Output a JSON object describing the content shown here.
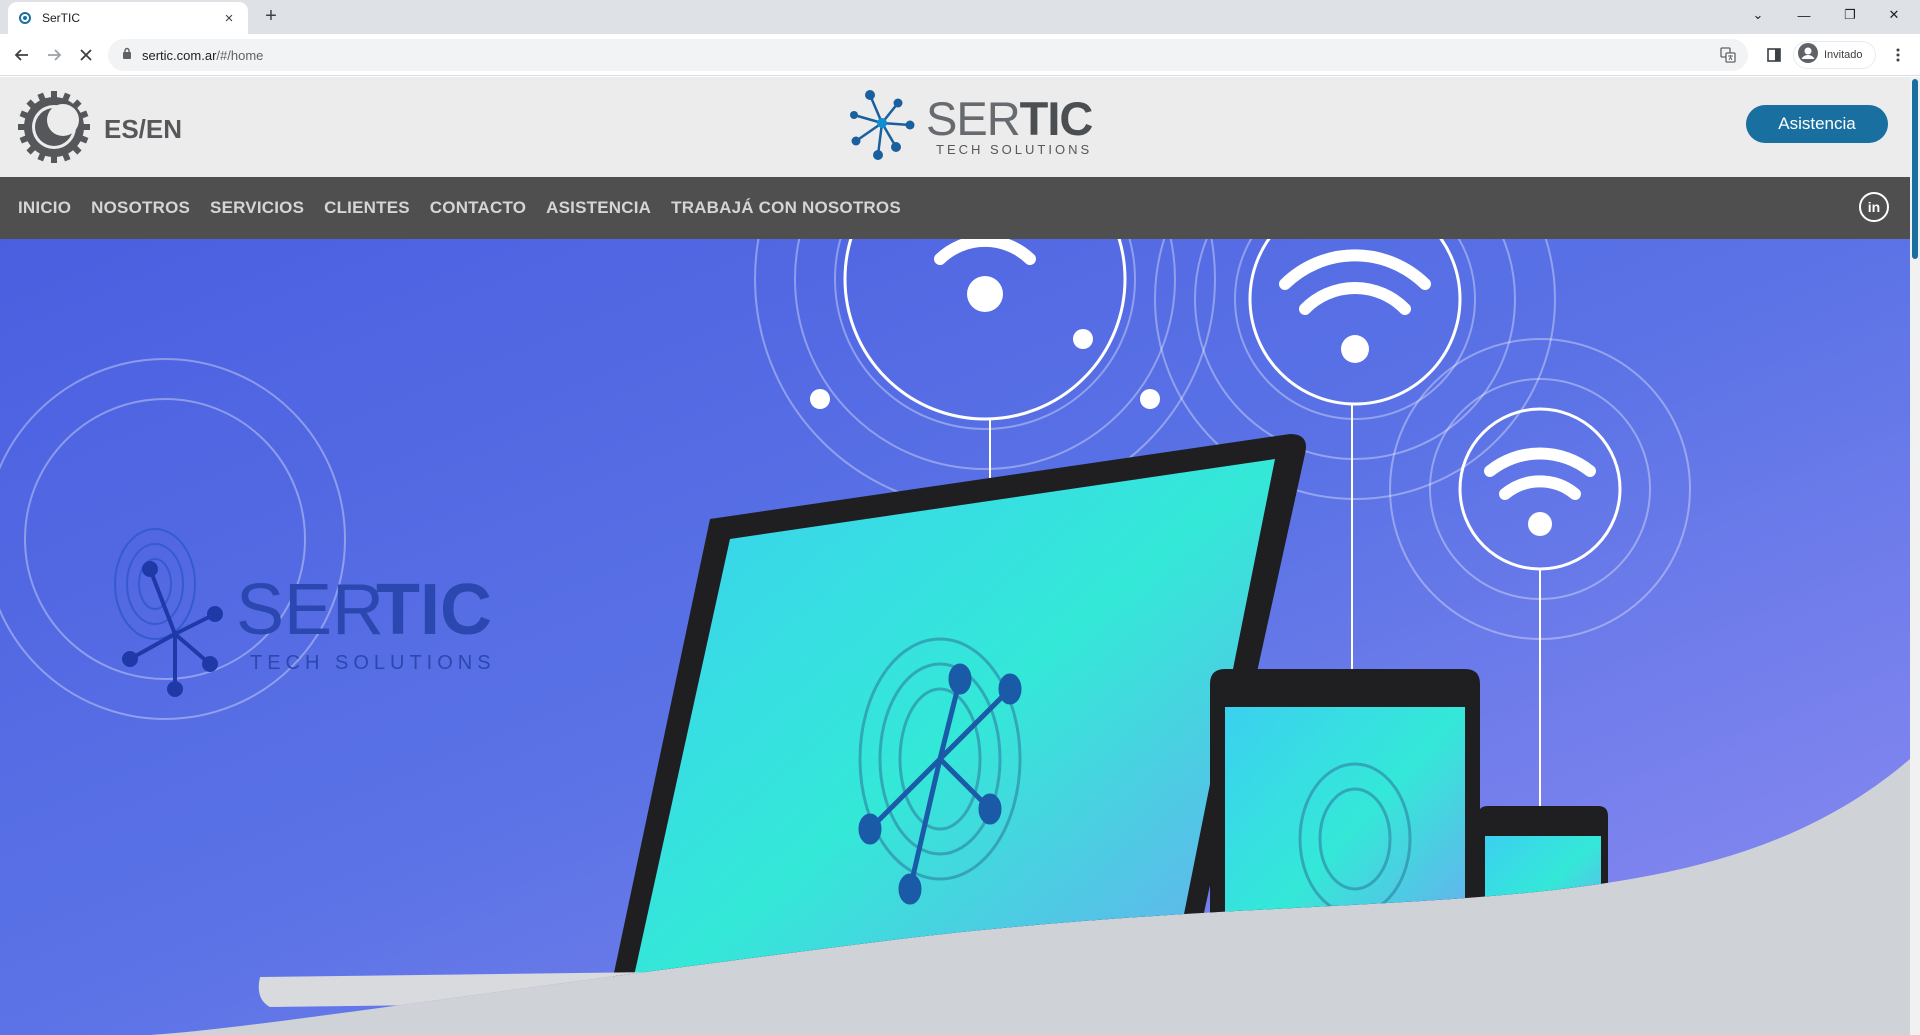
{
  "browser": {
    "tab_title": "SerTIC",
    "tab_close": "×",
    "new_tab": "+",
    "url_host": "sertic.com.ar",
    "url_path": "/#/home",
    "profile_label": "Invitado",
    "window_controls": [
      "⌄",
      "—",
      "❐",
      "✕"
    ]
  },
  "header": {
    "lang_toggle": "ES/EN",
    "brand_ser": "SER",
    "brand_tic": "TIC",
    "brand_tagline": "TECH SOLUTIONS",
    "asistencia_button": "Asistencia"
  },
  "nav": {
    "items": [
      "INICIO",
      "NOSOTROS",
      "SERVICIOS",
      "CLIENTES",
      "CONTACTO",
      "ASISTENCIA",
      "TRABAJÁ CON NOSOTROS"
    ],
    "linkedin": "in"
  },
  "hero": {
    "logo_ser": "SER",
    "logo_tic": "TIC",
    "logo_tagline": "TECH SOLUTIONS"
  },
  "colors": {
    "accent": "#1a6fa1",
    "navbar": "#4f4f4f",
    "header_bg": "#ececec",
    "hero_blue": "#4a63e0",
    "screen_cyan": "#30e6d9"
  }
}
